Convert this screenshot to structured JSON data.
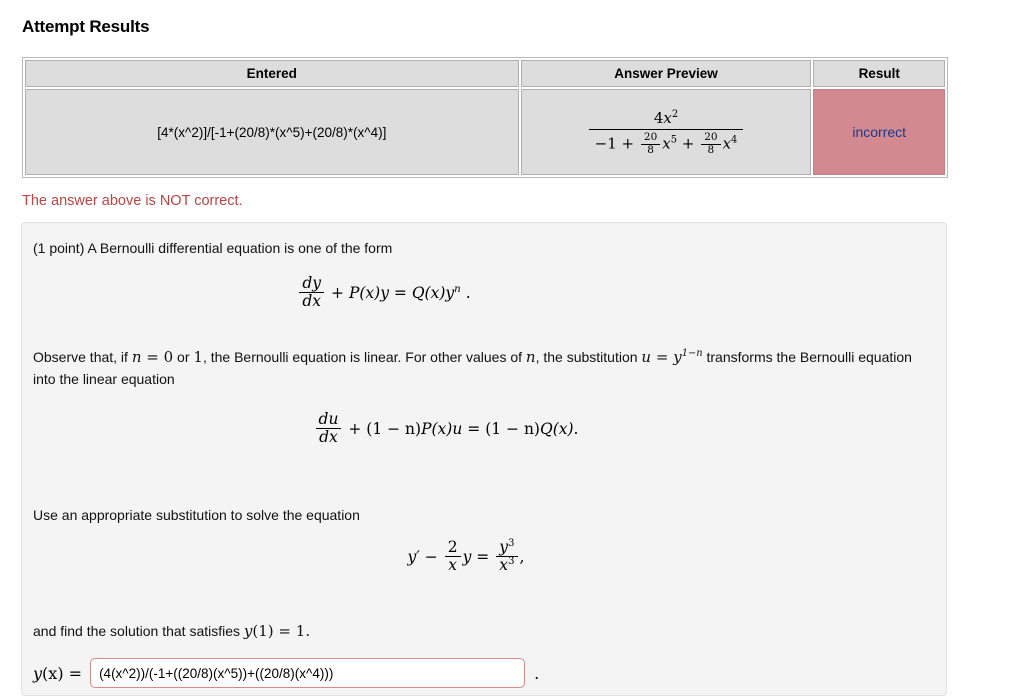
{
  "page": {
    "title": "Attempt Results"
  },
  "results_table": {
    "headers": [
      "Entered",
      "Answer Preview",
      "Result"
    ],
    "row": {
      "entered": "[4*(x^2)]/[-1+(20/8)*(x^5)+(20/8)*(x^4)]",
      "answer_preview": {
        "numerator": "4x²",
        "denominator": "−1 + (20/8)x⁵ + (20/8)x⁴",
        "num_coefficient": "4",
        "num_var": "x",
        "num_exponent": "2",
        "den_constant": "−1",
        "den_plus1": "+",
        "den_frac1_num": "20",
        "den_frac1_den": "8",
        "den_term1_var": "x",
        "den_term1_exp": "5",
        "den_plus2": "+",
        "den_frac2_num": "20",
        "den_frac2_den": "8",
        "den_term2_var": "x",
        "den_term2_exp": "4"
      },
      "result": "incorrect"
    },
    "colors": {
      "header_bg": "#dddddd",
      "cell_bg": "#dddddd",
      "incorrect_bg": "#d2898f",
      "incorrect_text": "#1b3a8f"
    }
  },
  "feedback": {
    "message": "The answer above is NOT correct.",
    "color": "#bb4444"
  },
  "problem": {
    "intro": "(1 point) A Bernoulli differential equation is one of the form",
    "equation1": {
      "frac_num": "dy",
      "frac_den": "dx",
      "plus": "+",
      "px": "P(x)y",
      "equals": "=",
      "qx": "Q(x)y",
      "exponent": "n",
      "period": "."
    },
    "observe_part1": "Observe that, if ",
    "observe_n": "n",
    "observe_eq": " = ",
    "observe_zero": "0",
    "observe_or": " or ",
    "observe_one": "1",
    "observe_part2": ", the Bernoulli equation is linear. For other values of ",
    "observe_n2": "n",
    "observe_part3": ", the substitution ",
    "observe_u": "u",
    "observe_u_eq": " = ",
    "observe_y": "y",
    "observe_y_exp": "1−n",
    "observe_part4": " transforms the Bernoulli equation into the linear equation",
    "equation2": {
      "frac_num": "du",
      "frac_den": "dx",
      "plus": "+",
      "coef1": "(1 − n)",
      "px": "P(x)u",
      "equals": "=",
      "coef2": "(1 − n)",
      "qx": "Q(x)",
      "period": "."
    },
    "substitution_prompt": "Use an appropriate substitution to solve the equation",
    "equation3": {
      "y_prime": "y′",
      "minus": "−",
      "frac_num": "2",
      "frac_den": "x",
      "y": "y",
      "equals": "=",
      "rhs_num_var": "y",
      "rhs_num_exp": "3",
      "rhs_den_var": "x",
      "rhs_den_exp": "3",
      "comma": ","
    },
    "condition_text": "and find the solution that satisfies ",
    "condition_math_y": "y",
    "condition_math_arg": "(1)",
    "condition_math_eq": " = ",
    "condition_math_val": "1",
    "condition_period": "."
  },
  "answer": {
    "label_y": "y",
    "label_arg": "(x)",
    "label_eq": " = ",
    "value": "(4(x^2))/(-1+((20/8)(x^5))+((20/8)(x^4)))",
    "placeholder": "",
    "trailing_period": ".",
    "border_color": "#d78c8c"
  }
}
